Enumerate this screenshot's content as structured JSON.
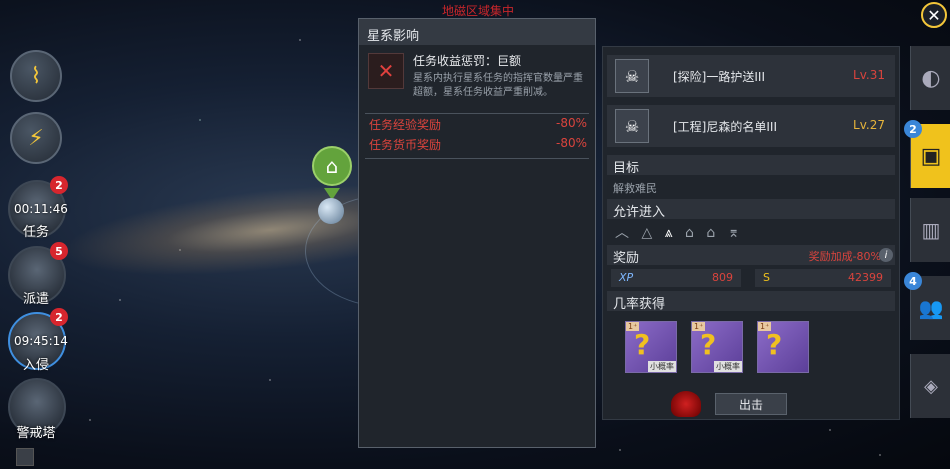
{
  "topbar": {
    "obscured_text": "地磁区域集中"
  },
  "left_menu": {
    "missions": [
      {
        "label": "任务",
        "timer": "00:11:46",
        "badge": "2"
      },
      {
        "label": "派遣",
        "timer": "",
        "badge": "5"
      },
      {
        "label": "入侵",
        "timer": "09:45:14",
        "badge": "2"
      },
      {
        "label": "警戒塔",
        "timer": "",
        "badge": ""
      }
    ]
  },
  "popup": {
    "title": "星系影响",
    "penalty_title": "任务收益惩罚：巨额",
    "penalty_desc": "星系内执行星系任务的指挥官数量严重超额，星系任务收益严重削减。",
    "rows": [
      {
        "label": "任务经验奖励",
        "value": "-80%"
      },
      {
        "label": "任务货币奖励",
        "value": "-80%"
      }
    ]
  },
  "panel": {
    "missions": [
      {
        "name": "[探险]一路护送III",
        "level": "Lv.31",
        "level_color": "#d9443d"
      },
      {
        "name": "[工程]尼森的名单III",
        "level": "Lv.27",
        "level_color": "#e6b43a"
      }
    ],
    "target_title": "目标",
    "target_value": "解救难民",
    "access_title": "允许进入",
    "reward_title": "奖励",
    "reward_bonus": "奖励加成-80%",
    "xp_label": "XP",
    "xp_value": "809",
    "s_label": "S",
    "s_value": "42399",
    "drop_title": "几率获得",
    "drops": [
      {
        "tag": "1⁺",
        "label": "小概率"
      },
      {
        "tag": "1⁺",
        "label": "小概率"
      },
      {
        "tag": "1⁺",
        "label": ""
      }
    ],
    "exit_label": "出击"
  },
  "tabs": {
    "badges": [
      "2",
      "4"
    ]
  },
  "colors": {
    "accent": "#f0c21c",
    "danger": "#d9443d",
    "panel": "#20252c"
  }
}
